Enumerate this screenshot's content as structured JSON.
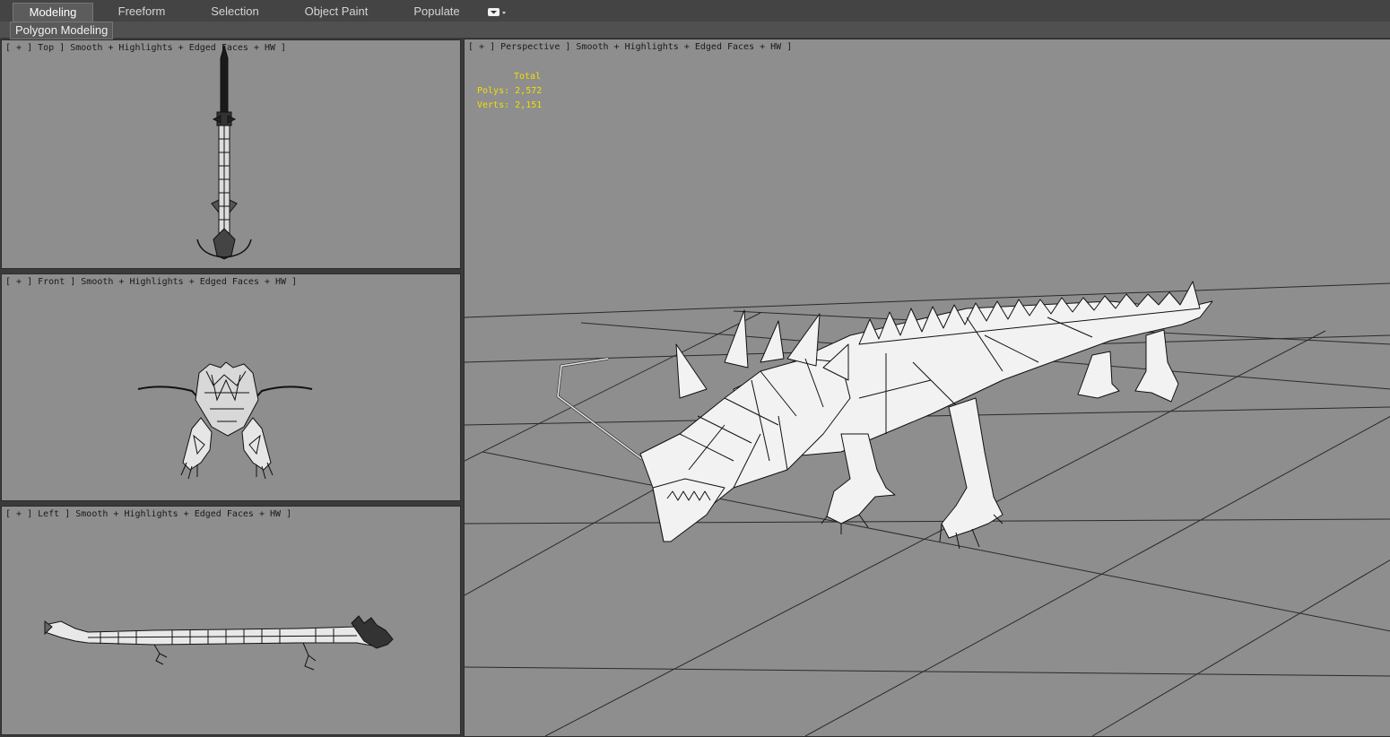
{
  "ribbon": {
    "tabs": [
      {
        "label": "Modeling",
        "active": true
      },
      {
        "label": "Freeform",
        "active": false
      },
      {
        "label": "Selection",
        "active": false
      },
      {
        "label": "Object Paint",
        "active": false
      },
      {
        "label": "Populate",
        "active": false
      }
    ],
    "panel_label": "Polygon Modeling",
    "menu_icon": "dropdown-icon"
  },
  "viewports": {
    "top": {
      "label": "[ + ] Top ] Smooth + Highlights + Edged Faces + HW ]"
    },
    "front": {
      "label": "[ + ] Front ] Smooth + Highlights + Edged Faces + HW ]"
    },
    "left": {
      "label": "[ + ] Left ] Smooth + Highlights + Edged Faces + HW ]"
    },
    "perspective": {
      "label": "[ + ] Perspective ] Smooth + Highlights + Edged Faces + HW ]",
      "stats": {
        "header": "Total",
        "polys_label": "Polys:",
        "polys_value": "2,572",
        "verts_label": "Verts:",
        "verts_value": "2,151"
      }
    }
  },
  "colors": {
    "viewport_bg": "#8e8e8e",
    "stats_text": "#f0e000",
    "mesh_fill": "#f2f2f2",
    "mesh_edge": "#111111"
  }
}
